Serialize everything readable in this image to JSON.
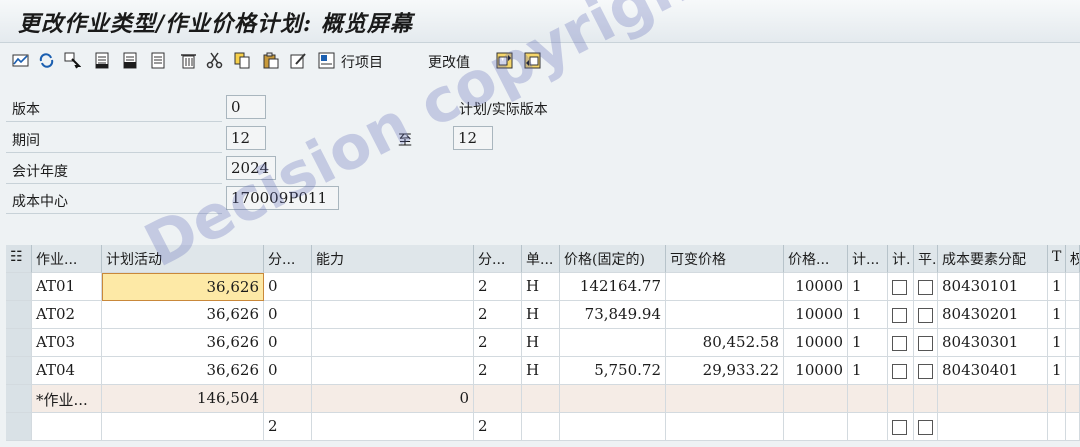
{
  "window": {
    "title": "更改作业类型/作业价格计划: 概览屏幕"
  },
  "toolbar": {
    "icons": [
      "chart-icon",
      "refresh-icon",
      "select-icon",
      "doc-icon",
      "doc-icon",
      "doc-icon",
      "trash-icon",
      "cut-icon",
      "copy-icon",
      "paste-icon",
      "edit-icon",
      "line-item-icon"
    ],
    "line_items_label": "行项目",
    "change_values_label": "更改值",
    "nav_icons": [
      "prev-page-icon",
      "next-page-icon"
    ]
  },
  "header": {
    "version_label": "版本",
    "version_value": "0",
    "plan_actual_label": "计划/实际版本",
    "period_label": "期间",
    "period_from": "12",
    "to_label": "至",
    "period_to": "12",
    "fiscal_year_label": "会计年度",
    "fiscal_year": "2024",
    "cost_center_label": "成本中心",
    "cost_center": "170009P011"
  },
  "table": {
    "columns": [
      "作业...",
      "计划活动",
      "分...",
      "能力",
      "分...",
      "单...",
      "价格(固定的)",
      "可变价格",
      "价格...",
      "计...",
      "计.",
      "平.",
      "成本要素分配",
      "T",
      "权"
    ],
    "rows": [
      {
        "activity": "AT01",
        "plan_activity": "36,626",
        "dist1": "0",
        "capacity": "",
        "dist2": "2",
        "unit": "H",
        "fixed_price": "142164.77",
        "variable_price": "",
        "price_unit": "10000",
        "plan_ind": "1",
        "cost_element": "80430101",
        "t": "1"
      },
      {
        "activity": "AT02",
        "plan_activity": "36,626",
        "dist1": "0",
        "capacity": "",
        "dist2": "2",
        "unit": "H",
        "fixed_price": "73,849.94",
        "variable_price": "",
        "price_unit": "10000",
        "plan_ind": "1",
        "cost_element": "80430201",
        "t": "1"
      },
      {
        "activity": "AT03",
        "plan_activity": "36,626",
        "dist1": "0",
        "capacity": "",
        "dist2": "2",
        "unit": "H",
        "fixed_price": "",
        "variable_price": "80,452.58",
        "price_unit": "10000",
        "plan_ind": "1",
        "cost_element": "80430301",
        "t": "1"
      },
      {
        "activity": "AT04",
        "plan_activity": "36,626",
        "dist1": "0",
        "capacity": "",
        "dist2": "2",
        "unit": "H",
        "fixed_price": "5,750.72",
        "variable_price": "29,933.22",
        "price_unit": "10000",
        "plan_ind": "1",
        "cost_element": "80430401",
        "t": "1"
      }
    ],
    "summary": {
      "activity": "*作业...",
      "plan_activity": "146,504",
      "capacity": "0"
    },
    "empty_row": {
      "dist1": "2",
      "dist2": "2"
    }
  },
  "watermark": "Decision copyright"
}
